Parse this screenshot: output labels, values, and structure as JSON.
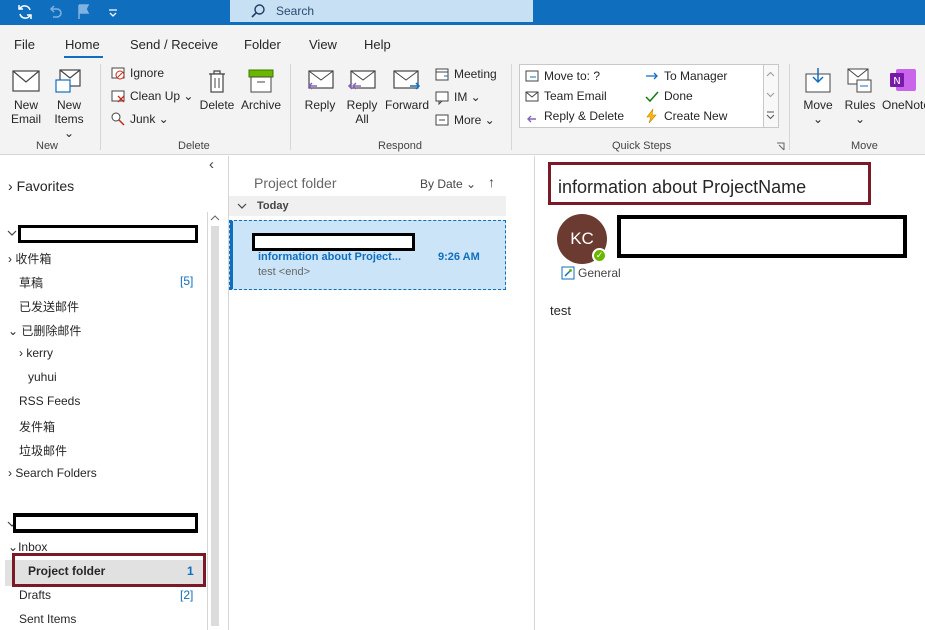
{
  "search": {
    "placeholder": "Search"
  },
  "menu": {
    "tabs": [
      "File",
      "Home",
      "Send / Receive",
      "Folder",
      "View",
      "Help"
    ],
    "active_index": 1
  },
  "ribbon": {
    "new_email": [
      "New",
      "Email"
    ],
    "new_items": [
      "New",
      "Items ⌄"
    ],
    "ignore": "Ignore",
    "clean_up": "Clean Up ⌄",
    "junk": "Junk ⌄",
    "delete": "Delete",
    "archive": "Archive",
    "reply": "Reply",
    "reply_all": [
      "Reply",
      "All"
    ],
    "forward": "Forward",
    "meeting": "Meeting",
    "im": "IM ⌄",
    "more": "More ⌄",
    "quick_steps": [
      "Move to: ?",
      "Team Email",
      "Reply & Delete",
      "To Manager",
      "Done",
      "Create New"
    ],
    "move": [
      "Move",
      "⌄"
    ],
    "rules": [
      "Rules",
      "⌄"
    ],
    "onenote": "OneNote",
    "groups": {
      "new": "New",
      "delete": "Delete",
      "respond": "Respond",
      "quick_steps": "Quick Steps",
      "move": "Move"
    }
  },
  "nav": {
    "favorites": "Favorites",
    "collapse_glyph": "‹",
    "account1_folders": [
      {
        "label": "收件箱",
        "count": ""
      },
      {
        "label": "草稿",
        "count": "[5]"
      },
      {
        "label": "已发送邮件",
        "count": ""
      },
      {
        "label": "已删除邮件",
        "count": ""
      },
      {
        "label": "kerry",
        "count": ""
      },
      {
        "label": "yuhui",
        "count": ""
      },
      {
        "label": "RSS Feeds",
        "count": ""
      },
      {
        "label": "发件箱",
        "count": ""
      },
      {
        "label": "垃圾邮件",
        "count": ""
      },
      {
        "label": "Search Folders",
        "count": ""
      }
    ],
    "account2_folders": [
      {
        "label": "Inbox",
        "count": ""
      },
      {
        "label": "Project folder",
        "count": "1"
      },
      {
        "label": "Drafts",
        "count": "[2]"
      },
      {
        "label": "Sent Items",
        "count": ""
      }
    ]
  },
  "message_list": {
    "folder_name": "Project folder",
    "sort": "By Date ⌄",
    "sort_arrow": "↑",
    "group_header": "Today",
    "messages": [
      {
        "subject": "information about Project...",
        "time": "9:26 AM",
        "preview": "test <end>"
      }
    ]
  },
  "reading": {
    "subject": "information about ProjectName",
    "avatar_initials": "KC",
    "category": "General",
    "body": "test"
  },
  "colors": {
    "brand": "#106ebe",
    "highlight_box": "#7b1a26",
    "selection": "#cce4f7"
  }
}
